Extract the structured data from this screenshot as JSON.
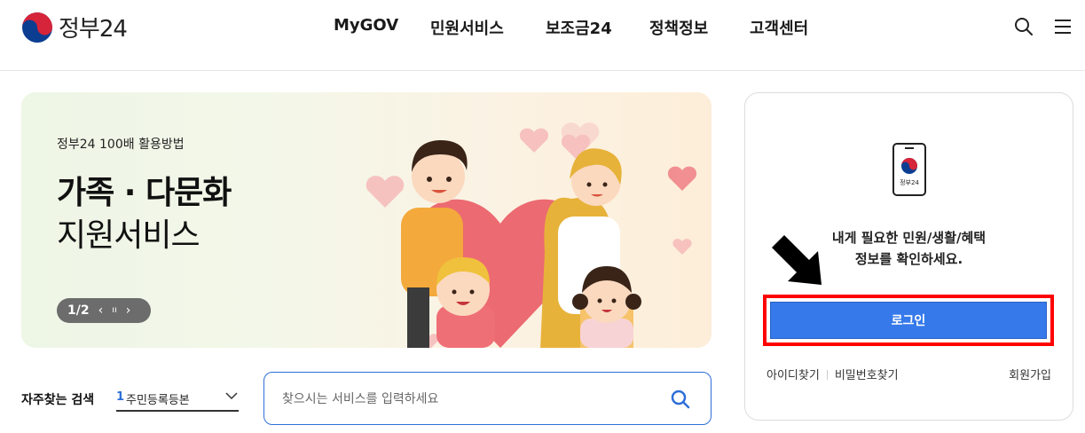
{
  "header": {
    "logo_text": "정부24",
    "nav": [
      {
        "label": "MyGOV"
      },
      {
        "label": "민원서비스"
      },
      {
        "label": "보조금24"
      },
      {
        "label": "정책정보"
      },
      {
        "label": "고객센터"
      }
    ],
    "icons": [
      "search-icon",
      "menu-icon"
    ]
  },
  "banner": {
    "subtitle": "정부24 100배 활용방법",
    "title_line1": "가족 · 다문화",
    "title_line2": "지원서비스",
    "pager": "1/2",
    "prev_symbol": "‹",
    "pause_symbol": "ıı",
    "next_symbol": "›"
  },
  "frequent_search": {
    "label": "자주찾는 검색",
    "rank": "1",
    "selected": "주민등록등본"
  },
  "search": {
    "placeholder": "찾으시는 서비스를 입력하세요"
  },
  "login": {
    "phone_label": "정부24",
    "message_line1": "내게 필요한 민원/생활/혜택",
    "message_line2": "정보를 확인하세요.",
    "button_label": "로그인",
    "find_id": "아이디찾기",
    "find_password": "비밀번호찾기",
    "signup": "회원가입"
  },
  "colors": {
    "accent": "#3579ea",
    "search_border": "#2e6fd8",
    "highlight": "#ff0000"
  }
}
